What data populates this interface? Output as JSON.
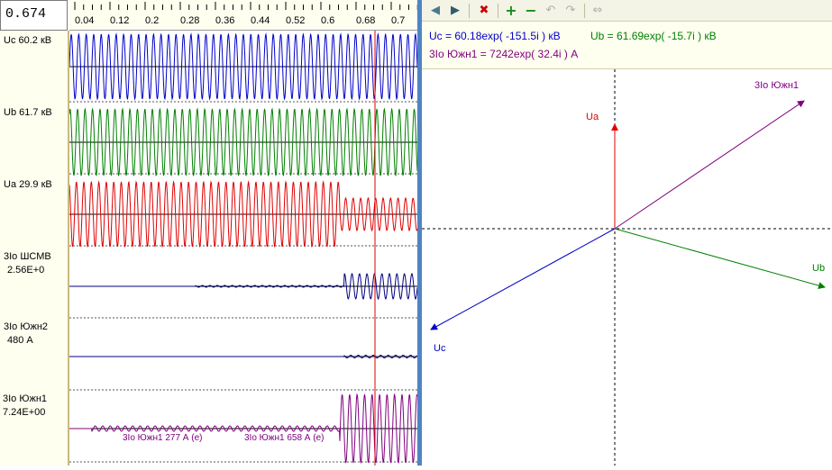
{
  "cursor": {
    "value": "0.674"
  },
  "time_axis": {
    "ticks": [
      "0.04",
      "0.12",
      "0.2",
      "0.28",
      "0.36",
      "0.44",
      "0.52",
      "0.6",
      "0.68",
      "0.7"
    ]
  },
  "channels": [
    {
      "name": "Uc",
      "value": "60.2 кВ",
      "color": "#0000c8"
    },
    {
      "name": "Ub",
      "value": "61.7 кВ",
      "color": "#008000"
    },
    {
      "name": "Ua",
      "value": "29.9 кВ",
      "color": "#e00000"
    },
    {
      "name": "3Io ШСМВ",
      "value": "2.56E+0",
      "color": "#000080"
    },
    {
      "name": "3Io Южн2",
      "value": "480 А",
      "color": "#000080"
    },
    {
      "name": "3Io Южн1",
      "value": "7.24E+00",
      "color": "#800080"
    }
  ],
  "wave_annotations": {
    "first": "3Io Южн1 277 А (е)",
    "second": "3Io Южн1 658 А (е)"
  },
  "toolbar": {
    "icons": [
      "arrow-left-icon",
      "arrow-right-icon",
      "delete-icon",
      "plus-icon",
      "minus-icon",
      "undo-icon",
      "redo-icon",
      "swap-icon"
    ]
  },
  "phasor_info": {
    "uc": "Uc = 60.18exp( -151.5i ) кВ",
    "ub": "Ub = 61.69exp( -15.7i ) кВ",
    "io": "3Io Южн1 = 7242exp( 32.4i ) А"
  },
  "phasors": [
    {
      "label": "Ua",
      "angle_deg": 90,
      "magnitude": 29.9,
      "color": "#e00000"
    },
    {
      "label": "Ub",
      "angle_deg": -15.7,
      "magnitude": 61.69,
      "color": "#008000"
    },
    {
      "label": "Uc",
      "angle_deg": -151.5,
      "magnitude": 60.18,
      "color": "#0000c8"
    },
    {
      "label": "3Io Южн1",
      "angle_deg": 32.4,
      "magnitude": 7242,
      "color": "#800080"
    }
  ],
  "colors": {
    "cursor_line": "#e00000",
    "divider": "#4f84c4",
    "label_bg": "#fffff0"
  }
}
